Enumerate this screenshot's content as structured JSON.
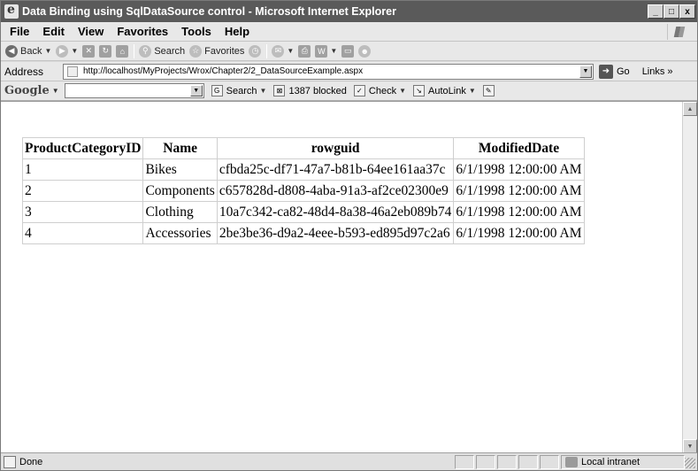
{
  "window": {
    "title": "Data Binding using SqlDataSource control - Microsoft Internet Explorer",
    "buttons": {
      "minimize": "_",
      "maximize": "□",
      "close": "x"
    }
  },
  "menu": {
    "items": [
      "File",
      "Edit",
      "View",
      "Favorites",
      "Tools",
      "Help"
    ]
  },
  "toolbar": {
    "back": "Back",
    "search": "Search",
    "favorites": "Favorites"
  },
  "address": {
    "label": "Address",
    "url": "http://localhost/MyProjects/Wrox/Chapter2/2_DataSourceExample.aspx",
    "go": "Go",
    "links": "Links »"
  },
  "google": {
    "logo": "Google",
    "search": "Search",
    "blocked": "1387 blocked",
    "check": "Check",
    "autolink": "AutoLink"
  },
  "grid": {
    "columns": [
      "ProductCategoryID",
      "Name",
      "rowguid",
      "ModifiedDate"
    ],
    "rows": [
      [
        "1",
        "Bikes",
        "cfbda25c-df71-47a7-b81b-64ee161aa37c",
        "6/1/1998 12:00:00 AM"
      ],
      [
        "2",
        "Components",
        "c657828d-d808-4aba-91a3-af2ce02300e9",
        "6/1/1998 12:00:00 AM"
      ],
      [
        "3",
        "Clothing",
        "10a7c342-ca82-48d4-8a38-46a2eb089b74",
        "6/1/1998 12:00:00 AM"
      ],
      [
        "4",
        "Accessories",
        "2be3be36-d9a2-4eee-b593-ed895d97c2a6",
        "6/1/1998 12:00:00 AM"
      ]
    ]
  },
  "status": {
    "text": "Done",
    "zone": "Local intranet"
  }
}
